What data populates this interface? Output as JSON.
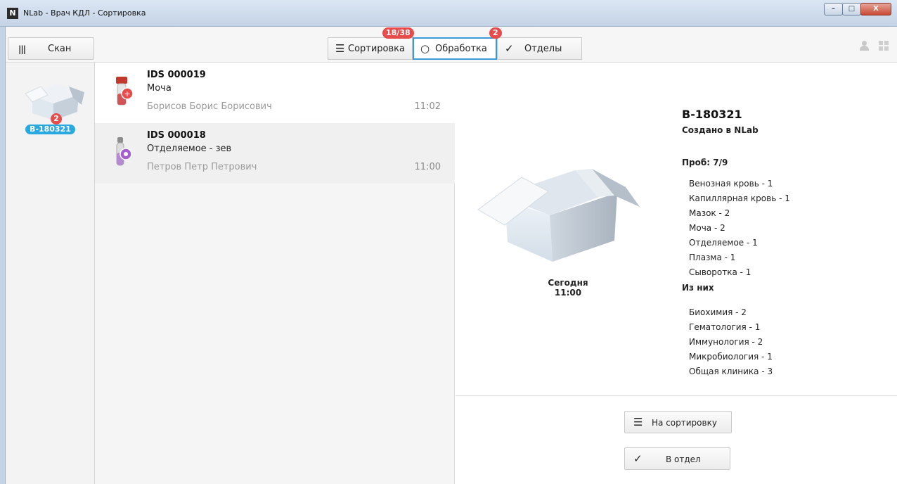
{
  "window": {
    "app_icon": "N",
    "title": "NLab - Врач КДЛ - Сортировка",
    "controls": {
      "minimize": "–",
      "maximize": "□",
      "close": "X"
    }
  },
  "toolbar": {
    "scan_label": "Скан",
    "tabs": [
      {
        "label": "Сортировка",
        "icon": "menu-icon",
        "badge": "18/38"
      },
      {
        "label": "Обработка",
        "icon": "circle-icon",
        "badge": "2",
        "active": true
      },
      {
        "label": "Отделы",
        "icon": "check-icon"
      }
    ]
  },
  "boxes": [
    {
      "code": "B-180321",
      "count": "2"
    }
  ],
  "samples": [
    {
      "code": "IDS 000019",
      "material": "Моча",
      "patient": "Борисов Борис Борисович",
      "time": "11:02",
      "icon": "urine-tube-icon"
    },
    {
      "code": "IDS 000018",
      "material": "Отделяемое - зев",
      "patient": "Петров Петр Петрович",
      "time": "11:00",
      "icon": "swab-tube-icon"
    }
  ],
  "detail": {
    "code": "B-180321",
    "created": "Создано в NLab",
    "date_label": "Сегодня",
    "time": "11:00",
    "probes_label": "Проб: 7/9",
    "materials": [
      "Венозная кровь - 1",
      "Капиллярная кровь - 1",
      "Мазок - 2",
      "Моча - 2",
      "Отделяемое - 1",
      "Плазма - 1",
      "Сыворотка - 1"
    ],
    "of_them_label": "Из них",
    "departments": [
      "Биохимия - 2",
      "Гематология - 1",
      "Иммунология - 2",
      "Микробиология - 1",
      "Общая клиника - 3"
    ],
    "actions": {
      "to_sorting": "На сортировку",
      "to_department": "В отдел"
    }
  },
  "colors": {
    "accent": "#3a9ad9",
    "badge": "#e74c4c",
    "box_pill": "#29a9e0"
  }
}
